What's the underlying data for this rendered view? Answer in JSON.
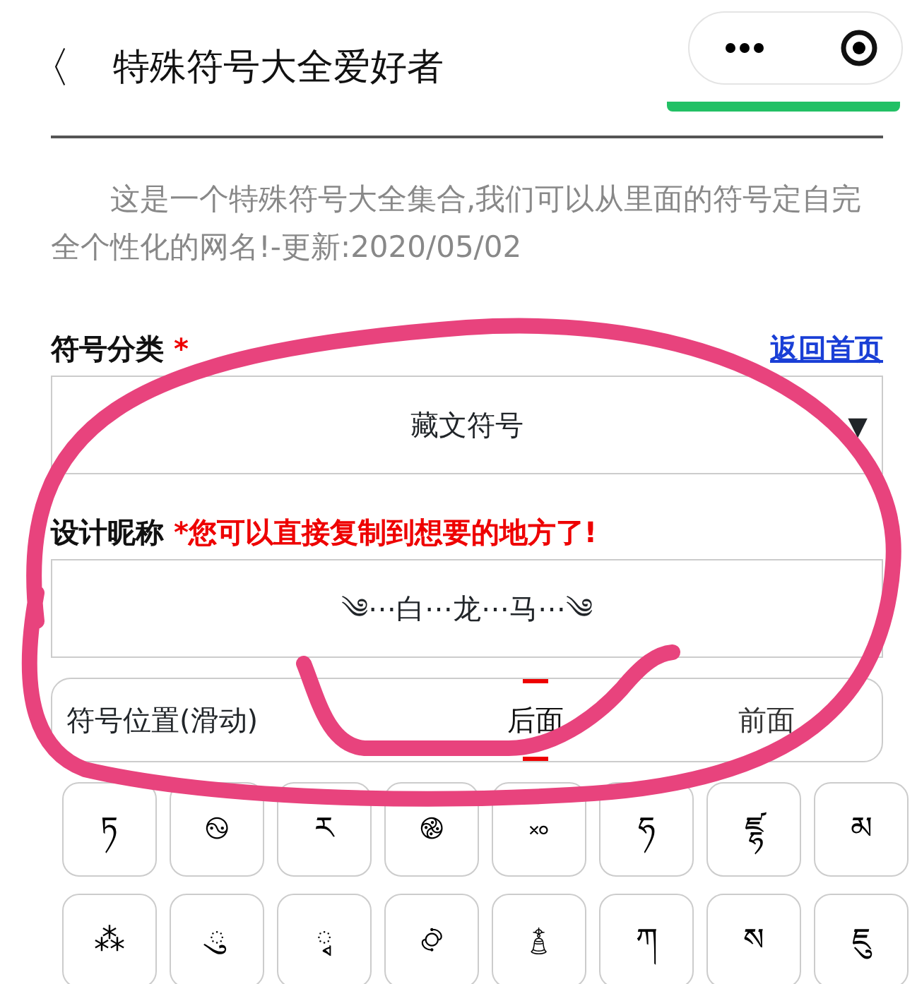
{
  "header": {
    "back": "〈",
    "title": "特殊符号大全爱好者"
  },
  "intro": "这是一个特殊符号大全集合,我们可以从里面的符号定自完全个性化的网名!-更新:2020/05/02",
  "category": {
    "label": "符号分类",
    "required": "*",
    "link": "返回首页",
    "value": "藏文符号",
    "caret": "▼"
  },
  "nickname": {
    "label": "设计昵称",
    "notice": "*您可以直接复制到想要的地方了!",
    "value": "༄⋯白⋯龙⋯马⋯༄"
  },
  "position": {
    "label": "符号位置(滑动)",
    "options": [
      {
        "label": "后面",
        "selected": true
      },
      {
        "label": "前面",
        "selected": false
      }
    ]
  },
  "symbols": [
    "ཏ",
    "࿊",
    "ར",
    "࿌",
    "࿎",
    "ཧ",
    "ཛྷ",
    "མ",
    "⁂",
    "◌ུ",
    "◌ྭ",
    "࿂",
    "࿄",
    "ཀ",
    "ས",
    "ཇུ"
  ]
}
